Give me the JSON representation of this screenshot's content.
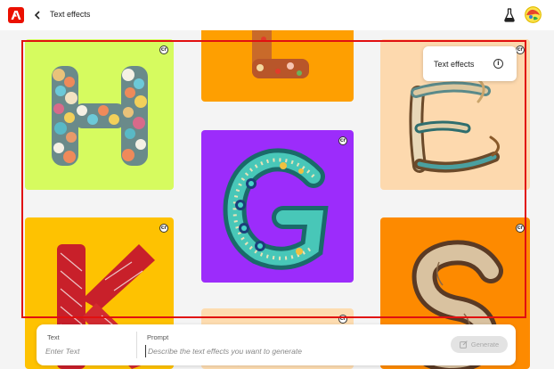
{
  "header": {
    "app_logo": "adobe-logo",
    "title": "Text effects",
    "icons": [
      "back-arrow-icon",
      "flask-icon",
      "avatar"
    ]
  },
  "tiles": [
    {
      "name": "tile-h",
      "letter": "H",
      "bg": "#d6fb5f",
      "style": "beads"
    },
    {
      "name": "tile-l",
      "letter": "L",
      "bg": "#fe9f01",
      "style": "food"
    },
    {
      "name": "tile-e",
      "letter": "E",
      "bg": "#fdd9ae",
      "style": "ropes"
    },
    {
      "name": "tile-g",
      "letter": "G",
      "bg": "#9c2cfb",
      "style": "peacock-feather"
    },
    {
      "name": "tile-k",
      "letter": "K",
      "bg": "#fec201",
      "style": "red-yarn"
    },
    {
      "name": "tile-bottom",
      "letter": "",
      "bg": "#fddcb0",
      "style": "partial"
    },
    {
      "name": "tile-s",
      "letter": "S",
      "bg": "#fd8a00",
      "style": "driftwood"
    }
  ],
  "tooltip": {
    "label": "Text effects",
    "info_icon": "info-icon"
  },
  "prompt_bar": {
    "text_label": "Text",
    "text_placeholder": "Enter Text",
    "prompt_label": "Prompt",
    "prompt_placeholder": "Describe the text effects you want to generate",
    "generate_label": "Generate"
  },
  "colors": {
    "highlight": "#e11010",
    "brand": "#eb1000"
  }
}
